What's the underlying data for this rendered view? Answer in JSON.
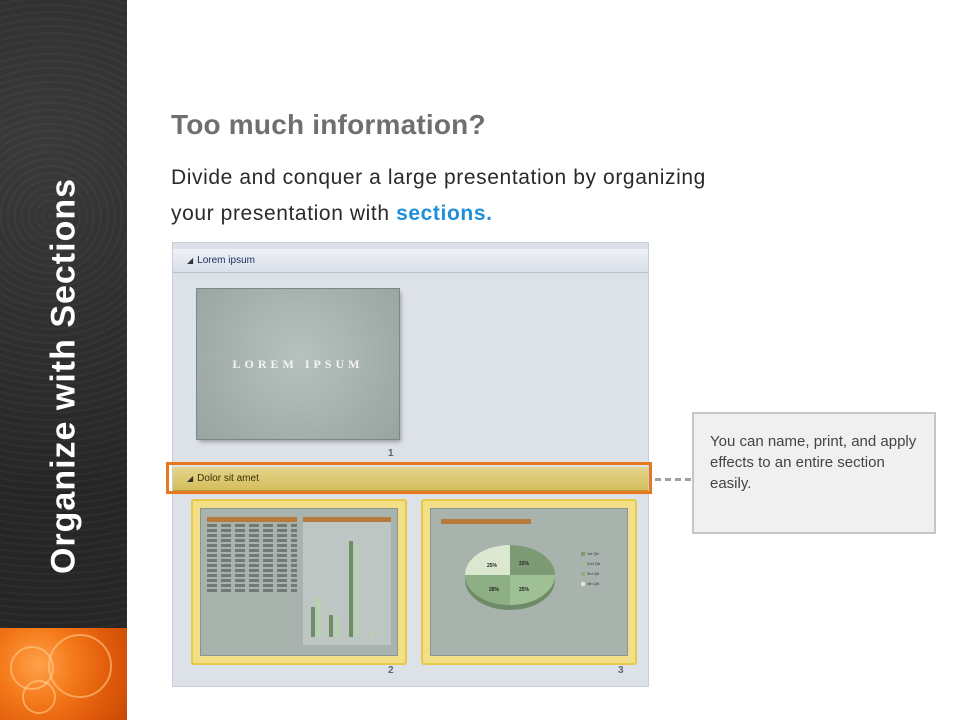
{
  "sidebar": {
    "title": "Organize with Sections"
  },
  "heading": "Too much information?",
  "subtitle": {
    "text": "Divide and conquer a large presentation by organizing your presentation with ",
    "highlight": "sections."
  },
  "sorter": {
    "section1": {
      "name": "Lorem ipsum",
      "slides": [
        {
          "number": "1",
          "title": "LOREM IPSUM"
        }
      ]
    },
    "section2": {
      "name": "Dolor sit amet",
      "slides": [
        {
          "number": "2"
        },
        {
          "number": "3",
          "pie_labels": [
            "22%",
            "25%",
            "28%",
            "25%"
          ]
        }
      ]
    },
    "legend": [
      "1st Qtr",
      "2nd Qtr",
      "3rd Qtr",
      "4th Qtr"
    ]
  },
  "callout": {
    "text": "You can name, print, and apply effects to an entire section easily."
  }
}
